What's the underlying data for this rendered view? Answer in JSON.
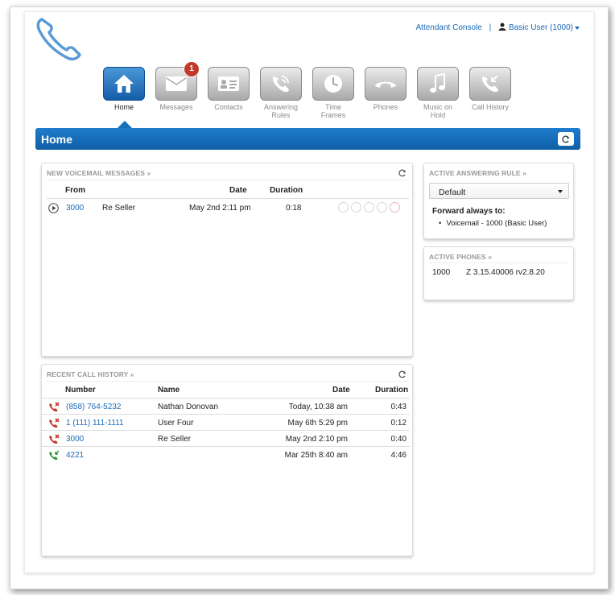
{
  "header": {
    "attendant_console": "Attendant Console",
    "separator": "|",
    "user_label": "Basic User (1000)"
  },
  "nav": {
    "items": [
      {
        "label": "Home",
        "icon": "home-icon"
      },
      {
        "label": "Messages",
        "icon": "envelope-icon",
        "badge": "1"
      },
      {
        "label": "Contacts",
        "icon": "contact-card-icon"
      },
      {
        "label_line1": "Answering",
        "label_line2": "Rules",
        "icon": "phone-ring-icon"
      },
      {
        "label_line1": "Time",
        "label_line2": "Frames",
        "icon": "clock-icon"
      },
      {
        "label": "Phones",
        "icon": "handset-icon"
      },
      {
        "label_line1": "Music on",
        "label_line2": "Hold",
        "icon": "music-note-icon"
      },
      {
        "label": "Call History",
        "icon": "call-history-icon"
      }
    ]
  },
  "page": {
    "title": "Home"
  },
  "voicemail": {
    "title": "NEW VOICEMAIL MESSAGES »",
    "headers": {
      "from": "From",
      "date": "Date",
      "duration": "Duration"
    },
    "rows": [
      {
        "number": "3000",
        "name": "Re Seller",
        "date": "May 2nd 2:11 pm",
        "duration": "0:18"
      }
    ]
  },
  "call_history": {
    "title": "RECENT CALL HISTORY »",
    "headers": {
      "number": "Number",
      "name": "Name",
      "date": "Date",
      "duration": "Duration"
    },
    "rows": [
      {
        "type": "missed",
        "number": "(858) 764-5232",
        "name": "Nathan Donovan",
        "date": "Today, 10:38 am",
        "duration": "0:43"
      },
      {
        "type": "missed",
        "number": "1 (111) 111-1111",
        "name": "User Four",
        "date": "May 6th 5:29 pm",
        "duration": "0:12"
      },
      {
        "type": "missed",
        "number": "3000",
        "name": "Re Seller",
        "date": "May 2nd 2:10 pm",
        "duration": "0:40"
      },
      {
        "type": "answered",
        "number": "4221",
        "name": "",
        "date": "Mar 25th 8:40 am",
        "duration": "4:46"
      }
    ]
  },
  "answering_rule": {
    "title": "ACTIVE ANSWERING RULE »",
    "selected": "Default",
    "forward_title": "Forward always to:",
    "forward_item": "Voicemail - 1000 (Basic User)"
  },
  "active_phones": {
    "title": "ACTIVE PHONES »",
    "rows": [
      {
        "id": "1000",
        "model": "Z 3.15.40006 rv2.8.20"
      }
    ]
  },
  "colors": {
    "accent": "#1570b9",
    "link": "#1a6ab7",
    "missed": "#c0392b",
    "answered": "#2e9a3a"
  }
}
